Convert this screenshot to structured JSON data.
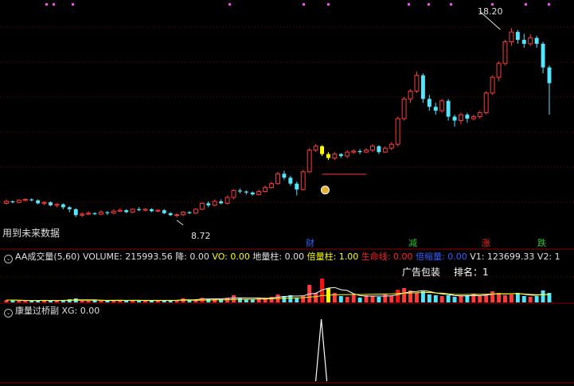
{
  "colors": {
    "background": "#000000",
    "grid": "#7a0000",
    "up": "#ff3b3b",
    "down": "#54e6ff",
    "highlight": "#ffff00",
    "text": "#e0e0e0",
    "white": "#ffffff",
    "green": "#30c030",
    "blue": "#3060ff",
    "magenta": "#ff40ff",
    "red": "#ff2020"
  },
  "main_chart": {
    "price_high_label": "18.20",
    "price_low_label": "8.72",
    "note": "用到未来数据"
  },
  "event_tags": [
    {
      "text": "财",
      "color": "#3060ff"
    },
    {
      "text": "减",
      "color": "#30c030"
    },
    {
      "text": "涨",
      "color": "#ff2020"
    },
    {
      "text": "跌",
      "color": "#30c030"
    }
  ],
  "volume_panel": {
    "collapse_icon": "circle-collapse-icon",
    "items": [
      {
        "text": "AA成交量(5,60)",
        "color": "#e0e0e0"
      },
      {
        "text": "VOLUME: 215993.56",
        "color": "#e0e0e0"
      },
      {
        "text": "降: 0.00",
        "color": "#e0e0e0"
      },
      {
        "text": "VO: 0.00",
        "color": "#ffff00"
      },
      {
        "text": "地量柱: 0.00",
        "color": "#e0e0e0"
      },
      {
        "text": "倍量柱: 1.00",
        "color": "#ffff00"
      },
      {
        "text": "生命线: 0.00",
        "color": "#ff2020"
      },
      {
        "text": "倍缩量: 0.00",
        "color": "#3060ff"
      },
      {
        "text": "V1: 123699.33",
        "color": "#e0e0e0"
      },
      {
        "text": "V2: 1",
        "color": "#e0e0e0"
      }
    ],
    "ad_text": "广告包装",
    "rank_text": "排名：1"
  },
  "signal_panel": {
    "collapse_icon": "circle-collapse-icon",
    "title": "康量过桥副",
    "xg_label": "XG: 0.00"
  },
  "chart_data": {
    "type": "candlestick",
    "price_range": [
      7.5,
      19.3
    ],
    "candles": [
      [
        9.3,
        9.4,
        9.5,
        9.25
      ],
      [
        9.4,
        9.35,
        9.45,
        9.3
      ],
      [
        9.35,
        9.45,
        9.5,
        9.3
      ],
      [
        9.45,
        9.5,
        9.55,
        9.4
      ],
      [
        9.5,
        9.45,
        9.55,
        9.4
      ],
      [
        9.45,
        9.3,
        9.5,
        9.25
      ],
      [
        9.3,
        9.35,
        9.4,
        9.2
      ],
      [
        9.35,
        9.2,
        9.4,
        9.15
      ],
      [
        9.2,
        9.25,
        9.3,
        9.1
      ],
      [
        9.25,
        9.1,
        9.3,
        9.0
      ],
      [
        9.1,
        9.0,
        9.15,
        8.85
      ],
      [
        9.0,
        8.7,
        9.05,
        8.6
      ],
      [
        8.7,
        8.75,
        8.85,
        8.6
      ],
      [
        8.75,
        8.8,
        8.9,
        8.7
      ],
      [
        8.8,
        8.75,
        8.85,
        8.7
      ],
      [
        8.75,
        8.85,
        8.95,
        8.7
      ],
      [
        8.85,
        8.8,
        8.9,
        8.7
      ],
      [
        8.8,
        8.9,
        9.0,
        8.75
      ],
      [
        8.9,
        8.95,
        9.05,
        8.85
      ],
      [
        8.95,
        8.85,
        9.0,
        8.8
      ],
      [
        8.85,
        9.0,
        9.05,
        8.8
      ],
      [
        9.0,
        8.95,
        9.1,
        8.9
      ],
      [
        8.95,
        9.0,
        9.05,
        8.9
      ],
      [
        9.0,
        8.9,
        9.05,
        8.85
      ],
      [
        8.9,
        8.95,
        9.0,
        8.85
      ],
      [
        8.95,
        8.8,
        9.0,
        8.75
      ],
      [
        8.8,
        8.7,
        8.85,
        8.65
      ],
      [
        8.7,
        8.72,
        8.8,
        8.6
      ],
      [
        8.72,
        8.85,
        8.9,
        8.65
      ],
      [
        8.85,
        8.8,
        8.9,
        8.75
      ],
      [
        8.8,
        9.0,
        9.05,
        8.75
      ],
      [
        9.0,
        9.3,
        9.35,
        8.95
      ],
      [
        9.3,
        9.2,
        9.4,
        9.1
      ],
      [
        9.2,
        9.4,
        9.5,
        9.15
      ],
      [
        9.4,
        9.3,
        9.5,
        9.25
      ],
      [
        9.3,
        9.6,
        9.7,
        9.25
      ],
      [
        9.6,
        9.95,
        10.0,
        9.5
      ],
      [
        9.95,
        9.9,
        10.05,
        9.8
      ],
      [
        9.9,
        9.85,
        9.95,
        9.75
      ],
      [
        9.85,
        9.75,
        9.9,
        9.7
      ],
      [
        9.75,
        9.9,
        10.0,
        9.7
      ],
      [
        9.9,
        10.1,
        10.2,
        9.85
      ],
      [
        10.1,
        10.3,
        10.4,
        10.05
      ],
      [
        10.3,
        10.8,
        10.9,
        10.25
      ],
      [
        10.8,
        10.6,
        10.95,
        10.5
      ],
      [
        10.6,
        10.3,
        10.7,
        10.2
      ],
      [
        10.3,
        10.0,
        10.4,
        9.7
      ],
      [
        10.0,
        10.9,
        11.0,
        9.95
      ],
      [
        10.9,
        12.0,
        12.1,
        10.85
      ],
      [
        12.0,
        12.2,
        12.3,
        11.9
      ],
      [
        12.2,
        11.8,
        12.25,
        11.7
      ],
      [
        11.8,
        11.6,
        11.9,
        11.5
      ],
      [
        11.6,
        11.8,
        11.9,
        11.5
      ],
      [
        11.8,
        11.7,
        11.85,
        11.6
      ],
      [
        11.7,
        11.9,
        12.0,
        11.6
      ],
      [
        11.9,
        11.95,
        12.05,
        11.8
      ],
      [
        11.95,
        11.9,
        12.05,
        11.8
      ],
      [
        11.9,
        12.0,
        12.1,
        11.85
      ],
      [
        12.0,
        12.2,
        12.3,
        11.9
      ],
      [
        12.2,
        11.9,
        12.25,
        11.8
      ],
      [
        11.9,
        12.1,
        12.2,
        11.85
      ],
      [
        12.1,
        12.3,
        12.4,
        12.0
      ],
      [
        12.3,
        13.6,
        13.7,
        12.2
      ],
      [
        13.6,
        14.6,
        14.7,
        13.5
      ],
      [
        14.6,
        15.0,
        15.1,
        14.4
      ],
      [
        15.0,
        15.8,
        16.0,
        14.9
      ],
      [
        15.8,
        14.6,
        15.9,
        14.4
      ],
      [
        14.6,
        14.2,
        14.8,
        14.0
      ],
      [
        14.2,
        14.0,
        14.4,
        13.8
      ],
      [
        14.0,
        14.5,
        14.6,
        13.9
      ],
      [
        14.5,
        13.7,
        14.6,
        13.5
      ],
      [
        13.7,
        13.5,
        13.8,
        13.2
      ],
      [
        13.5,
        13.8,
        13.9,
        13.3
      ],
      [
        13.8,
        13.6,
        13.9,
        13.4
      ],
      [
        13.6,
        13.7,
        13.8,
        13.5
      ],
      [
        13.7,
        13.9,
        14.0,
        13.6
      ],
      [
        13.9,
        14.9,
        15.0,
        13.8
      ],
      [
        14.9,
        15.7,
        15.8,
        14.8
      ],
      [
        15.7,
        16.4,
        16.5,
        15.5
      ],
      [
        16.4,
        17.5,
        17.6,
        16.3
      ],
      [
        17.5,
        18.0,
        18.2,
        17.3
      ],
      [
        18.0,
        17.6,
        18.1,
        17.4
      ],
      [
        17.6,
        17.4,
        17.9,
        17.2
      ],
      [
        17.4,
        17.7,
        17.9,
        17.3
      ],
      [
        17.7,
        17.4,
        17.8,
        17.2
      ],
      [
        17.4,
        16.2,
        17.5,
        15.9
      ],
      [
        16.2,
        15.4,
        16.3,
        13.8
      ]
    ],
    "highlight_indices": [
      50,
      51
    ],
    "ma_levels": [
      9.2,
      10.7
    ],
    "volume": [
      3,
      3,
      2,
      2,
      2,
      3,
      3,
      2,
      2,
      3,
      4,
      5,
      2,
      2,
      3,
      2,
      2,
      3,
      3,
      2,
      3,
      2,
      2,
      2,
      3,
      3,
      2,
      3,
      5,
      3,
      4,
      6,
      4,
      5,
      4,
      6,
      9,
      5,
      4,
      4,
      6,
      6,
      7,
      10,
      8,
      9,
      6,
      8,
      22,
      12,
      30,
      18,
      12,
      8,
      7,
      10,
      6,
      9,
      8,
      7,
      10,
      8,
      16,
      18,
      15,
      12,
      14,
      10,
      9,
      8,
      9,
      7,
      8,
      9,
      11,
      8,
      10,
      14,
      12,
      9,
      10,
      12,
      8,
      7,
      8,
      15,
      12
    ],
    "signal_spike_index": 49
  }
}
